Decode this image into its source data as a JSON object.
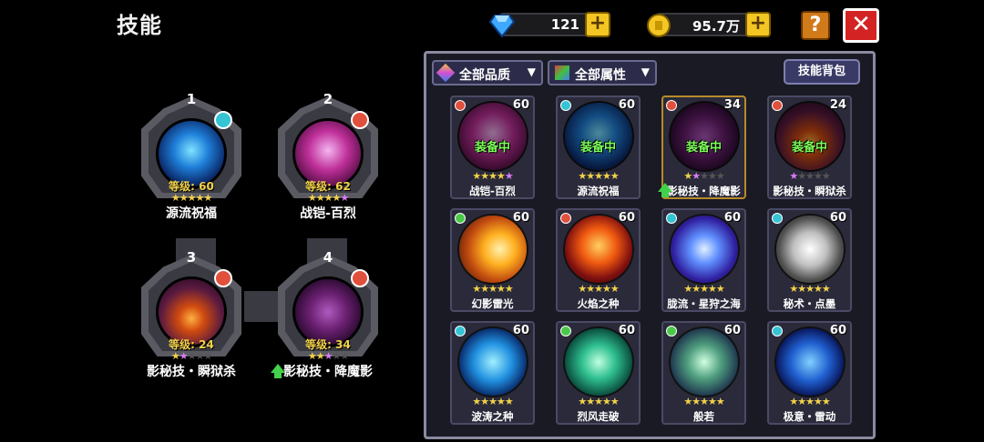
{
  "title": "技能",
  "currency": {
    "gems": "121",
    "gold": "95.7万"
  },
  "buttons": {
    "plus": "+",
    "help": "?",
    "close": "✕",
    "skill_bag": "技能背包"
  },
  "filters": {
    "quality": "全部品质",
    "attribute": "全部属性"
  },
  "equipped_level_prefix": "等级:",
  "equipped": [
    {
      "num": "1",
      "level": "60",
      "name": "源流祝福",
      "stars": "★★★★★",
      "element_color": "#34c4d4",
      "orb": "radial-gradient(circle at 50% 45%, #7fe3ff 0%, #1f7fd9 35%, #0b2a6a 70%, #050a20 100%)"
    },
    {
      "num": "2",
      "level": "62",
      "name": "战铠-百烈",
      "stars": "★★★★★",
      "element_color": "#e0503c",
      "orb": "radial-gradient(circle at 50% 45%, #f2b6f0 0%, #c0309a 40%, #5a1048 75%, #1a0515 100%)"
    },
    {
      "num": "3",
      "level": "24",
      "name": "影秘技・瞬狱杀",
      "stars": "★★★★★",
      "element_color": "#e0503c",
      "orb": "radial-gradient(circle at 50% 60%, #ffb040 0%, #d04a10 25%, #5a1a40 60%, #150515 100%)"
    },
    {
      "num": "4",
      "level": "34",
      "name": "影秘技・降魔影",
      "stars": "★★★★★",
      "element_color": "#e0503c",
      "orb": "radial-gradient(circle at 50% 50%, #b05ac0 0%, #6a2070 40%, #2a0a30 75%, #0a0210 100%)"
    }
  ],
  "equipped_label": "装备中",
  "skills": [
    {
      "name": "战铠-百烈",
      "level": "60",
      "equipped": true,
      "element_color": "#e0503c",
      "orb": "radial-gradient(circle at 50% 45%, #f2b6f0 0%, #c0309a 40%, #5a1048 75%, #1a0515 100%)"
    },
    {
      "name": "源流祝福",
      "level": "60",
      "equipped": true,
      "element_color": "#34c4d4",
      "orb": "radial-gradient(circle at 50% 45%, #7fe3ff 0%, #1f7fd9 35%, #0b2a6a 70%, #050a20 100%)"
    },
    {
      "name": "影秘技・降魔影",
      "level": "34",
      "equipped": true,
      "element_color": "#e0503c",
      "orb": "radial-gradient(circle at 50% 50%, #b05ac0 0%, #6a2070 40%, #2a0a30 75%, #0a0210 100%)"
    },
    {
      "name": "影秘技・瞬狱杀",
      "level": "24",
      "equipped": true,
      "element_color": "#e0503c",
      "orb": "radial-gradient(circle at 50% 60%, #ffb040 0%, #d04a10 25%, #5a1a40 60%, #150515 100%)"
    },
    {
      "name": "幻影雷光",
      "level": "60",
      "equipped": false,
      "element_color": "#4ac84a",
      "orb": "radial-gradient(circle at 60% 50%, #fff2b0 0%, #ffb020 30%, #c04a10 60%, #2a0a05 100%)"
    },
    {
      "name": "火焰之种",
      "level": "60",
      "equipped": false,
      "element_color": "#e0503c",
      "orb": "radial-gradient(circle at 50% 45%, #ffd060 0%, #f05a10 35%, #801010 65%, #1a0505 100%)"
    },
    {
      "name": "胧流・星狩之海",
      "level": "60",
      "equipped": false,
      "element_color": "#34c4d4",
      "orb": "radial-gradient(circle at 50% 50%, #e0f0ff 0%, #6090ff 30%, #3020a0 65%, #0a0520 100%)"
    },
    {
      "name": "秘术・点墨",
      "level": "60",
      "equipped": false,
      "element_color": "#34c4d4",
      "orb": "radial-gradient(circle at 50% 50%, #ffffff 0%, #c0c0c0 35%, #505050 65%, #101010 100%)"
    },
    {
      "name": "波涛之种",
      "level": "60",
      "equipped": false,
      "element_color": "#34c4d4",
      "orb": "radial-gradient(circle at 50% 50%, #a0f0ff 0%, #2090e0 40%, #0a3070 70%, #02081a 100%)"
    },
    {
      "name": "烈风走破",
      "level": "60",
      "equipped": false,
      "element_color": "#4ac84a",
      "orb": "radial-gradient(circle at 50% 50%, #c0ffe0 0%, #30c090 35%, #0a5040 70%, #021510 100%)"
    },
    {
      "name": "般若",
      "level": "60",
      "equipped": false,
      "element_color": "#4ac84a",
      "orb": "radial-gradient(circle at 50% 50%, #d0ffe0 0%, #50a080 35%, #203a50 70%, #050a15 100%)"
    },
    {
      "name": "极意・雷动",
      "level": "60",
      "equipped": false,
      "element_color": "#34c4d4",
      "orb": "radial-gradient(circle at 50% 50%, #80d0ff 0%, #2060d0 40%, #0a1a60 70%, #02051a 100%)"
    }
  ],
  "colors": {
    "star_gold": "#f2d24a",
    "star_purple": "#d97cf5",
    "equipped_text": "#7dff5a",
    "panel_border": "#8a8aa0"
  }
}
